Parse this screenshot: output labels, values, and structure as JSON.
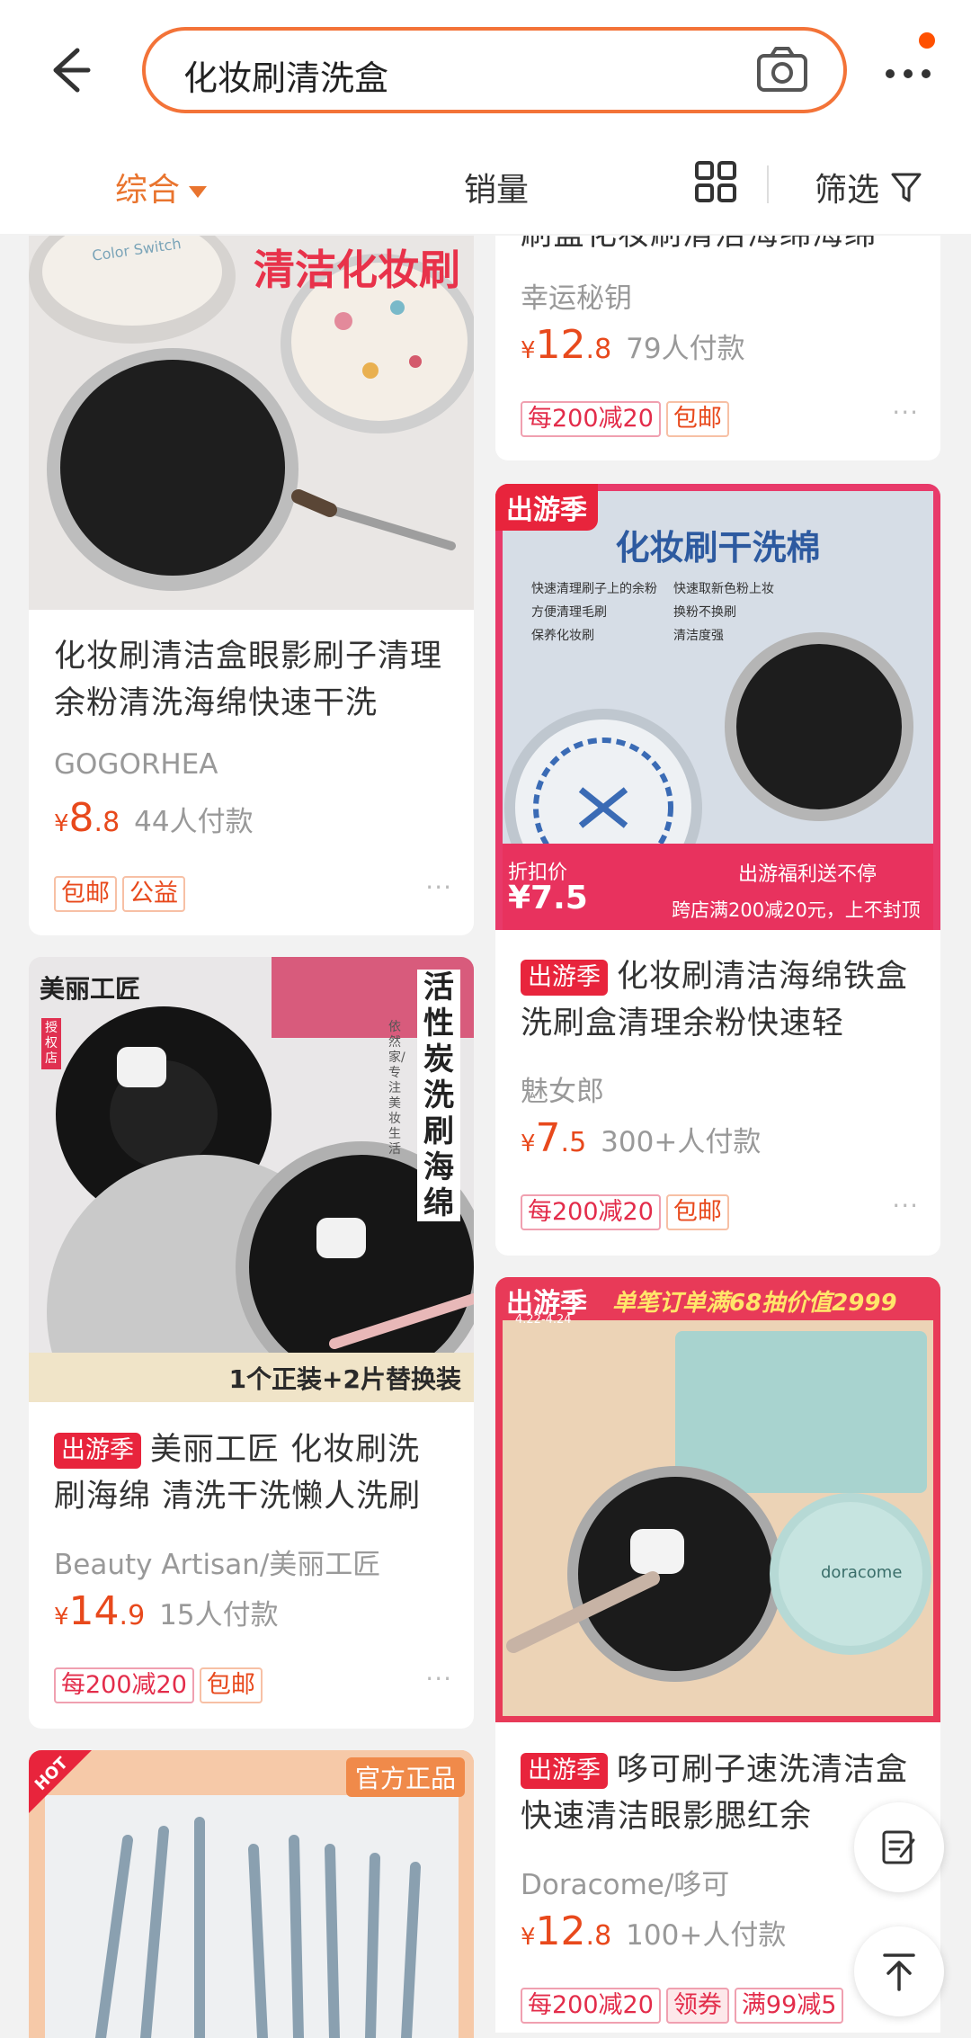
{
  "search": {
    "query": "化妆刷清洗盒"
  },
  "sort": {
    "tabs": [
      "综合",
      "销量"
    ],
    "filter_label": "筛选"
  },
  "cards": [
    {
      "id": "c0",
      "title_partial": "刷盒化妆刷清洁海绵海绵",
      "shop": "幸运秘钥",
      "price": {
        "currency": "¥",
        "int": "12",
        "dec": ".8"
      },
      "sales": "79人付款",
      "tags": [
        "每200减20",
        "包邮"
      ]
    },
    {
      "id": "c1",
      "image_text": "清洁化妆刷",
      "image_lid_text": "Color Switch",
      "title": "化妆刷清洁盒眼影刷子清理余粉清洗海绵快速干洗",
      "shop": "GOGORHEA",
      "price": {
        "currency": "¥",
        "int": "8",
        "dec": ".8"
      },
      "sales": "44人付款",
      "tags": [
        "包邮",
        "公益"
      ]
    },
    {
      "id": "c2",
      "image_corner": "出游季",
      "image_title": "化妆刷干洗棉",
      "image_checks": [
        "快速清理刷子上的余粉",
        "快速取新色粉上妆",
        "方便清理毛刷",
        "换粉不换刷",
        "保养化妆刷",
        "清洁度强"
      ],
      "image_price_label": "折扣价",
      "image_price": "¥7.5",
      "image_banner_top": "出游福利送不停",
      "image_banner_bottom": "跨店满200减20元，上不封顶",
      "badge": "出游季",
      "title": "化妆刷清洁海绵铁盒洗刷盒清理余粉快速轻",
      "shop": "魅女郎",
      "price": {
        "currency": "¥",
        "int": "7",
        "dec": ".5"
      },
      "sales": "300+人付款",
      "tags": [
        "每200减20",
        "包邮"
      ]
    },
    {
      "id": "c3",
      "image_brand": "美丽工匠",
      "image_side": "授权店",
      "image_vertical": "活性炭洗刷海绵",
      "image_sub": "依然家/专注美妆生活",
      "image_bottom": "1个正装+2片替换装",
      "badge": "出游季",
      "title": "美丽工匠 化妆刷洗刷海绵 清洗干洗懒人洗刷",
      "shop": "Beauty Artisan/美丽工匠",
      "price": {
        "currency": "¥",
        "int": "14",
        "dec": ".9"
      },
      "sales": "15人付款",
      "tags": [
        "每200减20",
        "包邮"
      ]
    },
    {
      "id": "c4",
      "image_corner": "出游季",
      "image_dates": "4.22-4.24",
      "image_banner": "单笔订单满68抽价值2999",
      "image_lid_text": "doracome",
      "badge": "出游季",
      "title": "哆可刷子速洗清洁盒快速清洁眼影腮红余",
      "shop": "Doracome/哆可",
      "price": {
        "currency": "¥",
        "int": "12",
        "dec": ".8"
      },
      "sales": "100+人付款",
      "tags": [
        "每200减20",
        "领券",
        "满99减5"
      ]
    },
    {
      "id": "c5",
      "image_corner": "HOT",
      "image_label": "官方正品"
    }
  ],
  "icons": {
    "back": "arrow-left-icon",
    "camera": "camera-icon",
    "more": "more-dots-icon",
    "grid": "grid-view-icon",
    "filter": "funnel-icon",
    "edit": "edit-icon",
    "top": "back-to-top-icon"
  },
  "colors": {
    "accent": "#e9742e",
    "price": "#e8491c",
    "badge": "#e8243c",
    "search_border": "#f37338"
  }
}
